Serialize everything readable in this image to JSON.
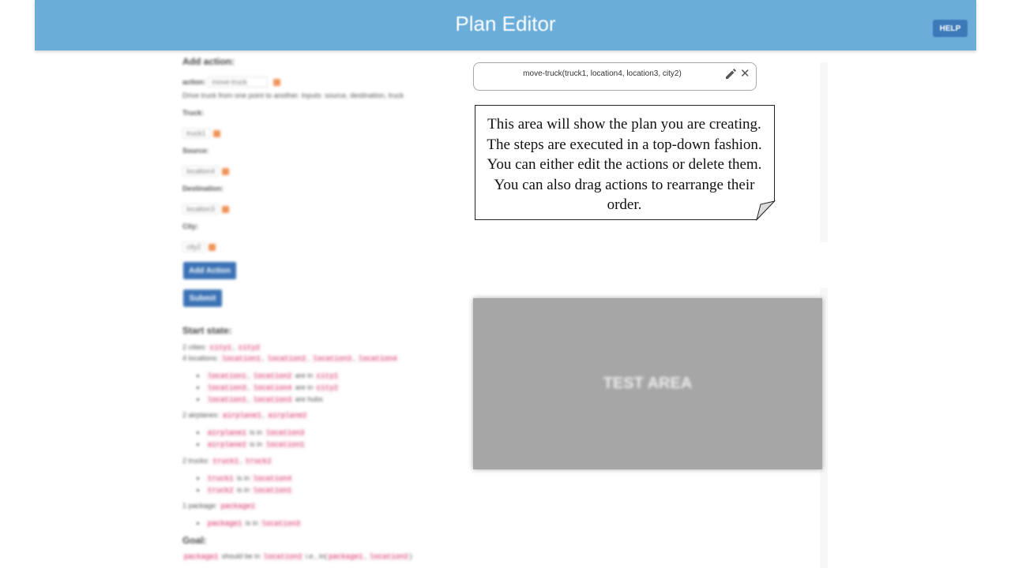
{
  "app": {
    "title": "Plan Editor",
    "help_label": "HELP"
  },
  "add_action": {
    "heading": "Add action:",
    "action_label": "action:",
    "action_value": "move-truck",
    "description": "Drive truck from one point to another. Inputs: source, destination, truck",
    "params": [
      {
        "label": "Truck:",
        "value": "truck1"
      },
      {
        "label": "Source:",
        "value": "location4"
      },
      {
        "label": "Destination:",
        "value": "location3"
      },
      {
        "label": "City:",
        "value": "city2"
      }
    ],
    "add_button": "Add Action",
    "submit_button": "Submit"
  },
  "start_state": {
    "heading": "Start state:",
    "cities_prefix": "2 cities:",
    "cities": [
      "city1",
      "city2"
    ],
    "locations_prefix": "4 locations:",
    "locations": [
      "location1",
      "location2",
      "location3",
      "location4"
    ],
    "location_facts": [
      {
        "a": "location1",
        "b": "location2",
        "verb": "are in",
        "c": "city1"
      },
      {
        "a": "location3",
        "b": "location4",
        "verb": "are in",
        "c": "city2"
      },
      {
        "a": "location1",
        "b": "location3",
        "verb": "are hubs",
        "c": ""
      }
    ],
    "airplanes_prefix": "2 airplanes:",
    "airplanes": [
      "airplane1",
      "airplane2"
    ],
    "airplane_facts": [
      {
        "a": "airplane1",
        "verb": "is in",
        "c": "location3"
      },
      {
        "a": "airplane2",
        "verb": "is in",
        "c": "location1"
      }
    ],
    "trucks_prefix": "2 trucks:",
    "trucks": [
      "truck1",
      "truck2"
    ],
    "truck_facts": [
      {
        "a": "truck1",
        "verb": "is in",
        "c": "location4"
      },
      {
        "a": "truck2",
        "verb": "is in",
        "c": "location1"
      }
    ],
    "package_prefix": "1 package:",
    "packages": [
      "package1"
    ],
    "package_facts": [
      {
        "a": "package1",
        "verb": "is in",
        "c": "location3"
      }
    ]
  },
  "goal": {
    "heading": "Goal:",
    "obj": "package1",
    "verb": "should be in",
    "target": "location2",
    "ie": "i.e., in(",
    "arg1": "package1",
    "arg2": "location2",
    "close": ")"
  },
  "plan": {
    "steps": [
      {
        "text": "move-truck(truck1, location4, location3, city2)"
      }
    ],
    "edit_icon": "pencil-icon",
    "delete_icon": "close-icon"
  },
  "callout": {
    "text": "This area will show the plan you are creating. The steps are executed in a top-down fashion. You can either edit the actions or delete them. You can also drag actions to rearrange their order."
  },
  "test_area": {
    "label": "TEST AREA"
  },
  "colors": {
    "header": "#6aadd9",
    "button": "#3b72b5",
    "code": "#d6336c",
    "accent": "#f0935a"
  }
}
